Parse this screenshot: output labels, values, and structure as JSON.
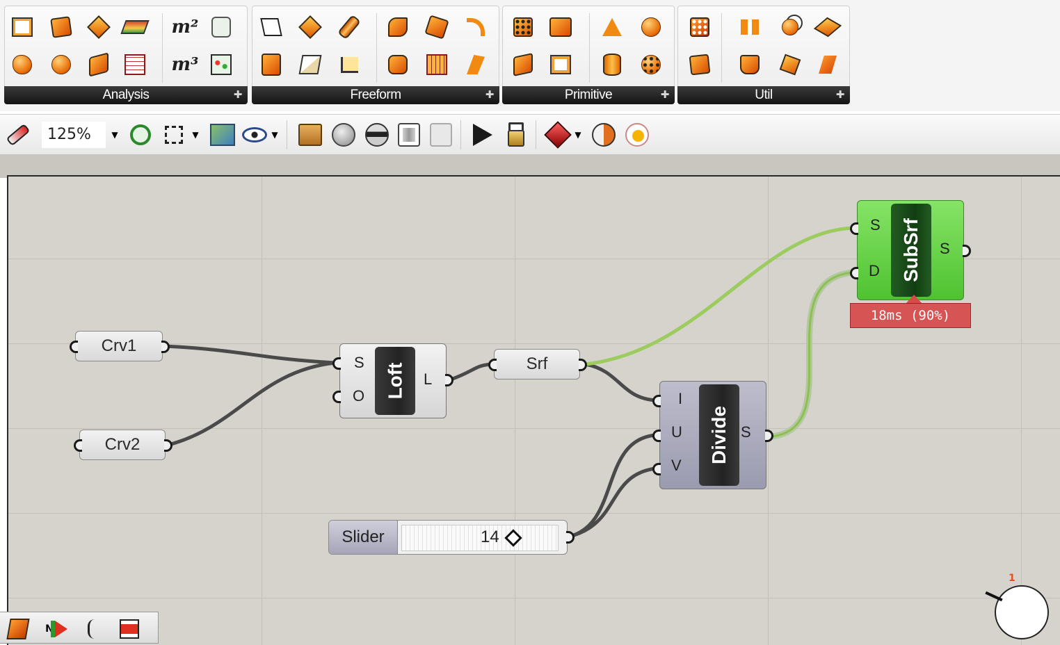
{
  "ribbon": {
    "panels": [
      {
        "label": "Analysis",
        "icons": [
          "bounding-box-icon",
          "deconstruct-vector-icon",
          "area-curve-icon",
          "surface-analysis-icon",
          "area-m2-icon",
          "excel-data-icon",
          "point-on-curve-icon",
          "curve-closest-point-icon",
          "plane-closest-point-icon",
          "point-grid-icon",
          "volume-m3-icon",
          "map-points-icon"
        ]
      },
      {
        "label": "Freeform",
        "icons": [
          "polyline-icon",
          "extrude-icon",
          "pipe-icon",
          "sweep-icon",
          "network-surface-icon",
          "rail-revolution-icon",
          "extrude-linear-icon",
          "boundary-box-icon",
          "ruled-surface-icon",
          "patch-icon",
          "grid-surface-icon",
          "fragment-icon"
        ]
      },
      {
        "label": "Primitive",
        "icons": [
          "dice-box-icon",
          "box-2pt-icon",
          "cone-icon",
          "sphere-icon",
          "box-corners-icon",
          "plane-box-icon",
          "cylinder-icon",
          "sphere-points-icon"
        ]
      },
      {
        "label": "Util",
        "icons": [
          "surface-frames-icon",
          "divide-split-icon",
          "brep-edges-icon",
          "offset-surface-icon",
          "isotrim-icon",
          "cap-holes-icon",
          "flip-surface-icon",
          "retrim-icon"
        ]
      }
    ]
  },
  "toolbar": {
    "zoom": "125%",
    "icons": [
      "sketch-pen-icon",
      "zoom-extents-icon",
      "focus-icon",
      "named-views-icon",
      "preview-eye-icon",
      "box-preview-icon",
      "wireframe-preview-icon",
      "shaded-preview-icon",
      "selected-only-icon",
      "no-preview-icon",
      "run-solver-icon",
      "lock-solver-icon",
      "material-shader-icon",
      "color-swatch-icon",
      "bake-egg-icon"
    ]
  },
  "canvas": {
    "params": [
      {
        "id": "crv1",
        "label": "Crv1"
      },
      {
        "id": "crv2",
        "label": "Crv2"
      },
      {
        "id": "srf",
        "label": "Srf"
      }
    ],
    "loft": {
      "name": "Loft",
      "inputs": [
        "S",
        "O"
      ],
      "outputs": [
        "L"
      ]
    },
    "divide": {
      "name": "Divide",
      "inputs": [
        "I",
        "U",
        "V"
      ],
      "outputs": [
        "S"
      ]
    },
    "subsrf": {
      "name": "SubSrf",
      "inputs": [
        "S",
        "D"
      ],
      "outputs": [
        "S"
      ]
    },
    "slider": {
      "name": "Slider",
      "value": "14"
    },
    "profiler": "18ms (90%)",
    "compass_marker": "1"
  },
  "widgets": {
    "icons": [
      "widget-surface-icon",
      "widget-north-arrow-icon",
      "widget-markov-icon",
      "widget-align-icon"
    ],
    "north_label": "N"
  },
  "colors": {
    "canvas": "#d6d3cd",
    "wire": "#4a4a4a",
    "wire_selected": "#9ccc60",
    "subsrf_fill": "#6bd64b",
    "profiler": "#d64a4a",
    "icon_orange": "#f08a10"
  }
}
